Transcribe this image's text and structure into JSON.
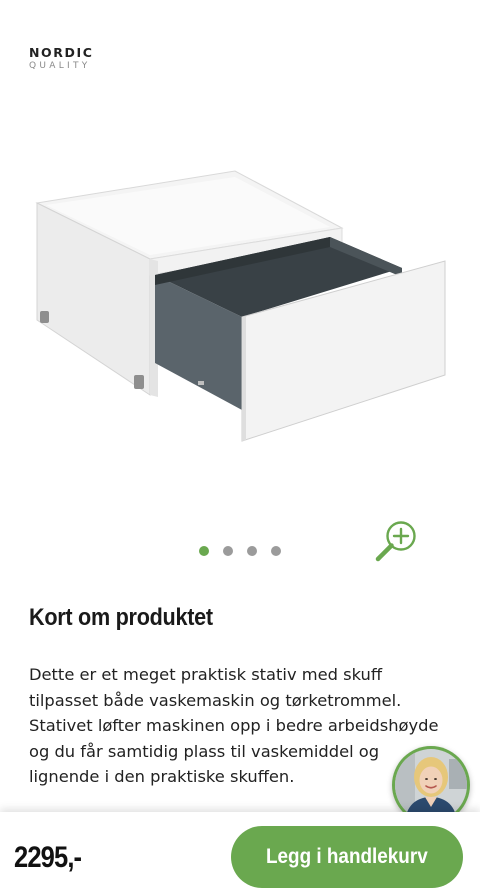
{
  "brand": {
    "name": "NORDIC",
    "tagline": "QUALITY"
  },
  "gallery": {
    "image_alt": "Stativ med skuff",
    "dot_count": 4,
    "active_index": 0,
    "zoom_icon": "zoom-in-icon"
  },
  "product": {
    "section_title": "Kort om produktet",
    "description": "Dette er et meget praktisk stativ med skuff tilpasset både vaskemaskin og tørketrommel. Stativet løfter maskinen opp i bedre arbeidshøyde og du får samtidig plass til vaskemiddel og lignende i den praktiske skuffen."
  },
  "chat": {
    "avatar_icon": "support-agent-avatar"
  },
  "purchase": {
    "price": "2295,-",
    "add_to_cart_label": "Legg i handlekurv"
  },
  "colors": {
    "accent": "#6aa84f",
    "dot_inactive": "#9b9b9b",
    "text": "#1a1a1a"
  }
}
